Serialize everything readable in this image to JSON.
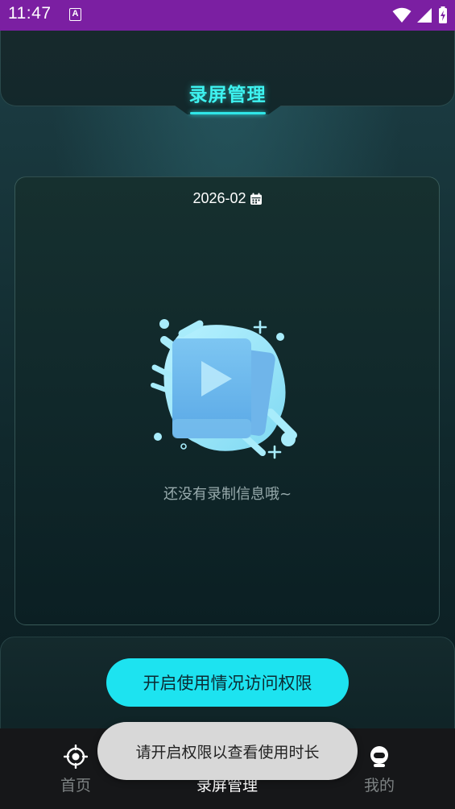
{
  "status_bar": {
    "time": "11:47",
    "notification_icon": "a-font-icon",
    "icons": [
      "wifi-icon",
      "signal-icon",
      "battery-charging-icon"
    ]
  },
  "header": {
    "title": "录屏管理",
    "accent_color": "#3ef3f0"
  },
  "records": {
    "date_filter": "2026-02",
    "date_icon": "calendar-icon",
    "empty_message": "还没有录制信息哦~",
    "empty_illustration": "video-empty-illustration"
  },
  "actions": {
    "permission_button": "开启使用情况访问权限",
    "button_color": "#1de3f0"
  },
  "toast": {
    "message": "请开启权限以查看使用时长"
  },
  "bottom_nav": {
    "items": [
      {
        "label": "首页",
        "icon": "target-icon"
      },
      {
        "label": "录屏管理",
        "icon": "screen-record-icon"
      },
      {
        "label": "我的",
        "icon": "profile-icon"
      }
    ],
    "active_index": 1
  }
}
